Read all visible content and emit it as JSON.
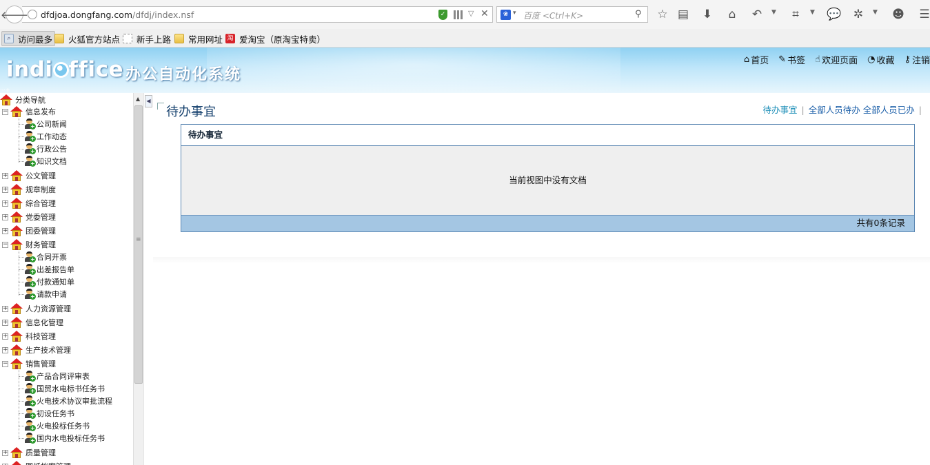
{
  "browser": {
    "url_host": "dfdjoa.dongfang.com",
    "url_path": "/dfdj/index.nsf",
    "url_prefix": "",
    "search_placeholder": "百度 <Ctrl+K>",
    "bookmarks": [
      {
        "label": "访问最多",
        "icon": "most-visited-icon"
      },
      {
        "label": "火狐官方站点",
        "icon": "folder-icon"
      },
      {
        "label": "新手上路",
        "icon": "page-icon"
      },
      {
        "label": "常用网址",
        "icon": "folder-icon"
      },
      {
        "label": "爱淘宝（原淘宝特卖）",
        "icon": "taobao-icon"
      }
    ]
  },
  "header": {
    "logo_part1": "indi",
    "logo_part2": "ffice",
    "system_name": "办公自动化系统",
    "nav": [
      {
        "label": "首页",
        "icon": "home-icon"
      },
      {
        "label": "书签",
        "icon": "pin-icon"
      },
      {
        "label": "欢迎页面",
        "icon": "hand-icon"
      },
      {
        "label": "收藏",
        "icon": "folder-icon"
      },
      {
        "label": "注销",
        "icon": "key-icon"
      }
    ]
  },
  "tree": {
    "root": "分类导航",
    "categories": [
      {
        "label": "信息发布",
        "expanded": true,
        "children": [
          "公司新闻",
          "工作动态",
          "行政公告",
          "知识文档"
        ]
      },
      {
        "label": "公文管理",
        "expanded": false,
        "children": []
      },
      {
        "label": "规章制度",
        "expanded": false,
        "children": []
      },
      {
        "label": "综合管理",
        "expanded": false,
        "children": []
      },
      {
        "label": "党委管理",
        "expanded": false,
        "children": []
      },
      {
        "label": "团委管理",
        "expanded": false,
        "children": []
      },
      {
        "label": "财务管理",
        "expanded": true,
        "children": [
          "合同开票",
          "出差报告单",
          "付款通知单",
          "请款申请"
        ]
      },
      {
        "label": "人力资源管理",
        "expanded": false,
        "children": []
      },
      {
        "label": "信息化管理",
        "expanded": false,
        "children": []
      },
      {
        "label": "科技管理",
        "expanded": false,
        "children": []
      },
      {
        "label": "生产技术管理",
        "expanded": false,
        "children": []
      },
      {
        "label": "销售管理",
        "expanded": true,
        "children": [
          "产品合同评审表",
          "国贸水电标书任务书",
          "火电技术协议审批流程",
          "初设任务书",
          "火电投标任务书",
          "国内水电投标任务书"
        ]
      },
      {
        "label": "质量管理",
        "expanded": false,
        "children": []
      },
      {
        "label": "图纸档案管理",
        "expanded": false,
        "children": []
      }
    ]
  },
  "main": {
    "title": "待办事宜",
    "view_links": [
      {
        "label": "待办事宜",
        "active": true
      },
      {
        "label": "全部人员待办",
        "active": false
      },
      {
        "label": "全部人员已办",
        "active": false
      }
    ],
    "panel_title": "待办事宜",
    "empty_message": "当前视图中没有文档",
    "record_count": "共有0条记录"
  }
}
